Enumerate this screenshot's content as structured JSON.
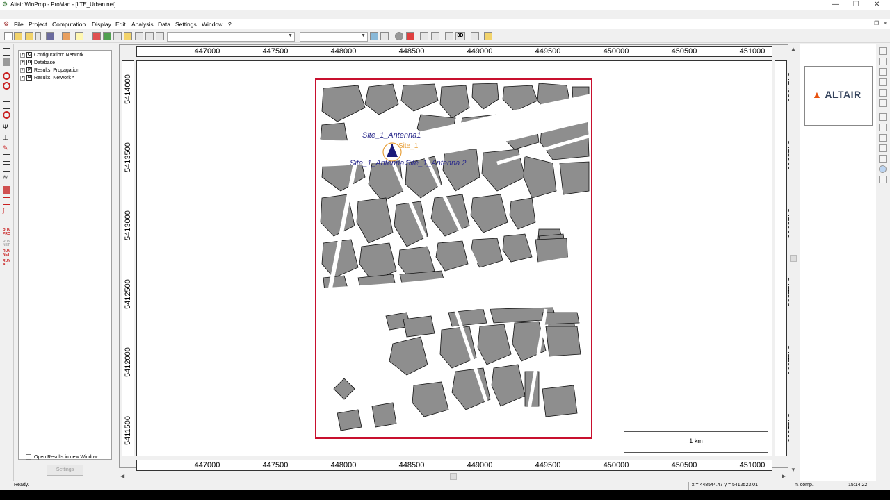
{
  "window": {
    "title": "Altair WinProp - ProMan - [LTE_Urban.net]",
    "minimize": "—",
    "restore": "❐",
    "close": "✕"
  },
  "menu": [
    "File",
    "Project",
    "Computation",
    "Display",
    "Edit",
    "Analysis",
    "Data",
    "Settings",
    "Window",
    "?"
  ],
  "toolbar": {
    "combo1_value": "",
    "combo2_value": "",
    "btn_3d": "3D"
  },
  "tree": {
    "items": [
      {
        "letter": "C",
        "label": "Configuration: Network"
      },
      {
        "letter": "D",
        "label": "Database"
      },
      {
        "letter": "P",
        "label": "Results: Propagation"
      },
      {
        "letter": "N",
        "label": "Results: Network *"
      }
    ]
  },
  "options": {
    "open_results_label": "Open Results in new Window",
    "settings_button": "Settings"
  },
  "map": {
    "x_ticks": [
      "447000",
      "447500",
      "448000",
      "448500",
      "449000",
      "449500",
      "450000",
      "450500",
      "451000"
    ],
    "y_ticks": [
      "5414000",
      "5413500",
      "5413000",
      "5412500",
      "5412000",
      "5411500"
    ],
    "site_labels": {
      "antenna_top": "Site_1_Antenna1",
      "site": "Site_1",
      "antenna_bottom_left": "Site_1_Antenna 3",
      "antenna_bottom_right": "Site_1_Antenna 2"
    },
    "scale_label": "1 km"
  },
  "brand": {
    "logo_text": "ALTAIR",
    "accent_color": "#e8520f",
    "text_color": "#33425b"
  },
  "status": {
    "ready": "Ready.",
    "coords": "x = 448544.47 y = 5412523.01",
    "comp": "n. comp.",
    "time": "15:14:22"
  }
}
